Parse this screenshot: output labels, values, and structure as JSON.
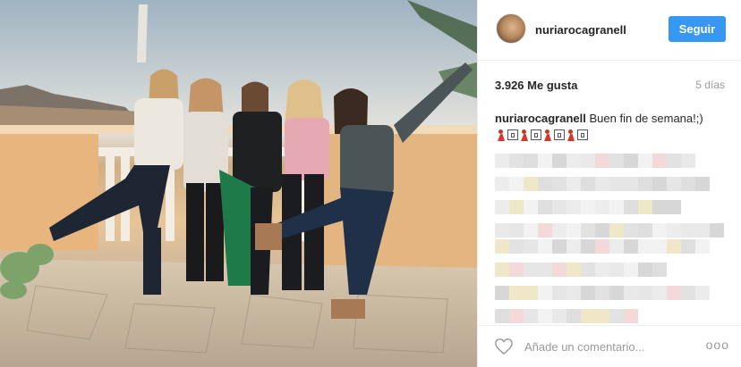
{
  "post": {
    "photo_alt": "",
    "username": "nuriarocagranell",
    "follow_label": "Seguir",
    "likes": "3.926 Me gusta",
    "time": "5 días",
    "caption_user": "nuriarocagranell",
    "caption_text": "Buen fin de semana!;)",
    "caption_emojis": [
      "dancer",
      "box",
      "dancer",
      "box",
      "dancer",
      "box",
      "dancer",
      "box"
    ],
    "comment_placeholder": "Añade un comentario...",
    "more_label": "ooo"
  },
  "icons": {
    "like": "heart-outline-icon",
    "more": "ellipsis-icon"
  },
  "colors": {
    "accent": "#3897f0",
    "text": "#262626",
    "muted": "#999999",
    "border": "#efefef"
  }
}
